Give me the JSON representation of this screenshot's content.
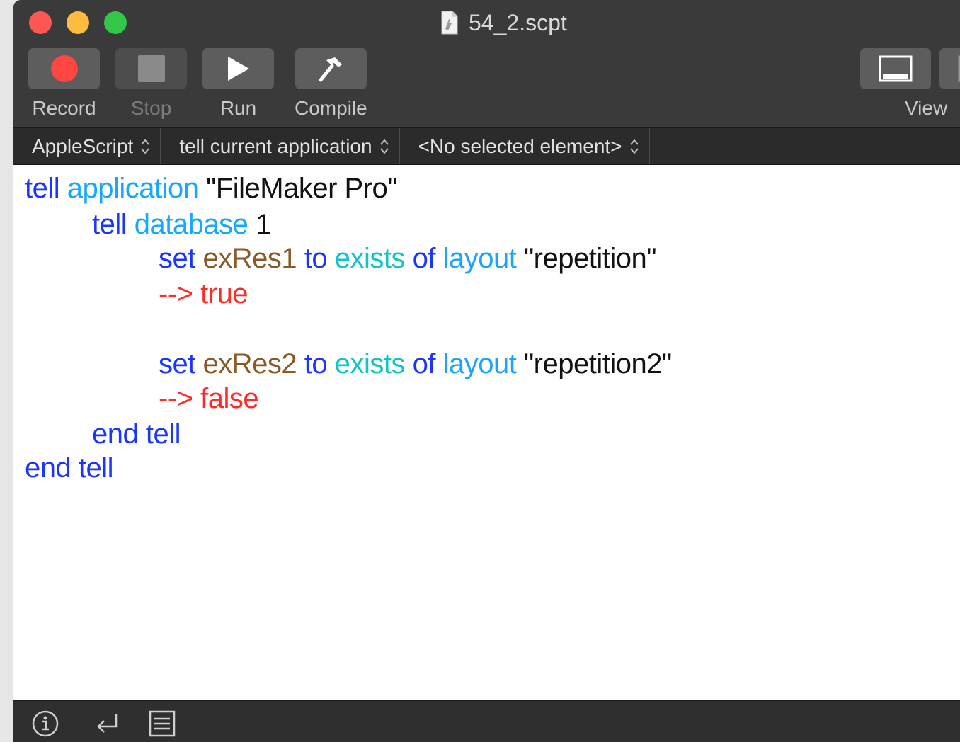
{
  "window": {
    "title": "54_2.scpt"
  },
  "toolbar": {
    "record_label": "Record",
    "stop_label": "Stop",
    "run_label": "Run",
    "compile_label": "Compile",
    "view_label": "View"
  },
  "navbar": {
    "language": "AppleScript",
    "target": "tell current application",
    "element": "<No selected element>"
  },
  "code": {
    "line1": {
      "tell": "tell",
      "application": "application",
      "name": "\"FileMaker Pro\""
    },
    "line2": {
      "tell": "tell",
      "database": "database",
      "num": "1"
    },
    "line3": {
      "set": "set",
      "var": "exRes1",
      "to": "to",
      "exists": "exists",
      "of": "of",
      "layout": "layout",
      "name": "\"repetition\""
    },
    "line4": {
      "result": "--> true"
    },
    "line5": {
      "set": "set",
      "var": "exRes2",
      "to": "to",
      "exists": "exists",
      "of": "of",
      "layout": "layout",
      "name": "\"repetition2\""
    },
    "line6": {
      "result": "--> false"
    },
    "line7": {
      "text": "end tell"
    },
    "line8": {
      "text": "end tell"
    }
  },
  "colors": {
    "keyword": "#1a35ff",
    "application_class": "#16a8ff",
    "variable": "#8a5a26",
    "command": "#12c4c8",
    "result": "#ff2a26",
    "record": "#ff4640"
  },
  "icons": {
    "info": "info-icon",
    "return": "return-arrow-icon",
    "list": "list-icon"
  }
}
